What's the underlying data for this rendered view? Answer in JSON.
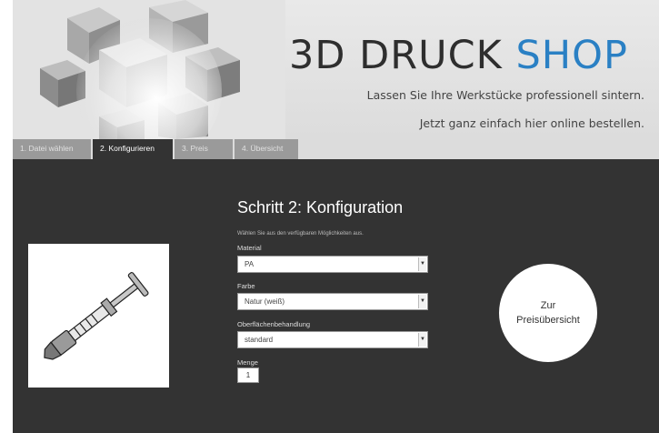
{
  "header": {
    "brand_main": "3D DRUCK ",
    "brand_accent": "SHOP",
    "tagline_1": "Lassen Sie Ihre Werkstücke professionell sintern.",
    "tagline_2": "Jetzt ganz einfach hier online bestellen.",
    "accent_color": "#2a80c4"
  },
  "tabs": [
    {
      "label": "1. Datei wählen",
      "active": false
    },
    {
      "label": "2. Konfigurieren",
      "active": true
    },
    {
      "label": "3. Preis",
      "active": false
    },
    {
      "label": "4. Übersicht",
      "active": false
    }
  ],
  "config": {
    "title": "Schritt 2: Konfiguration",
    "description": "Wählen Sie aus den verfügbaren Möglichkeiten aus.",
    "material_label": "Material",
    "material_value": "PA",
    "color_label": "Farbe",
    "color_value": "Natur (weiß)",
    "surface_label": "Oberflächenbehandlung",
    "surface_value": "standard",
    "quantity_label": "Menge",
    "quantity_value": "1"
  },
  "action": {
    "line1": "Zur",
    "line2": "Preisübersicht"
  },
  "icons": {
    "dropdown": "chevron-down-icon",
    "preview": "syringe-model-preview"
  }
}
